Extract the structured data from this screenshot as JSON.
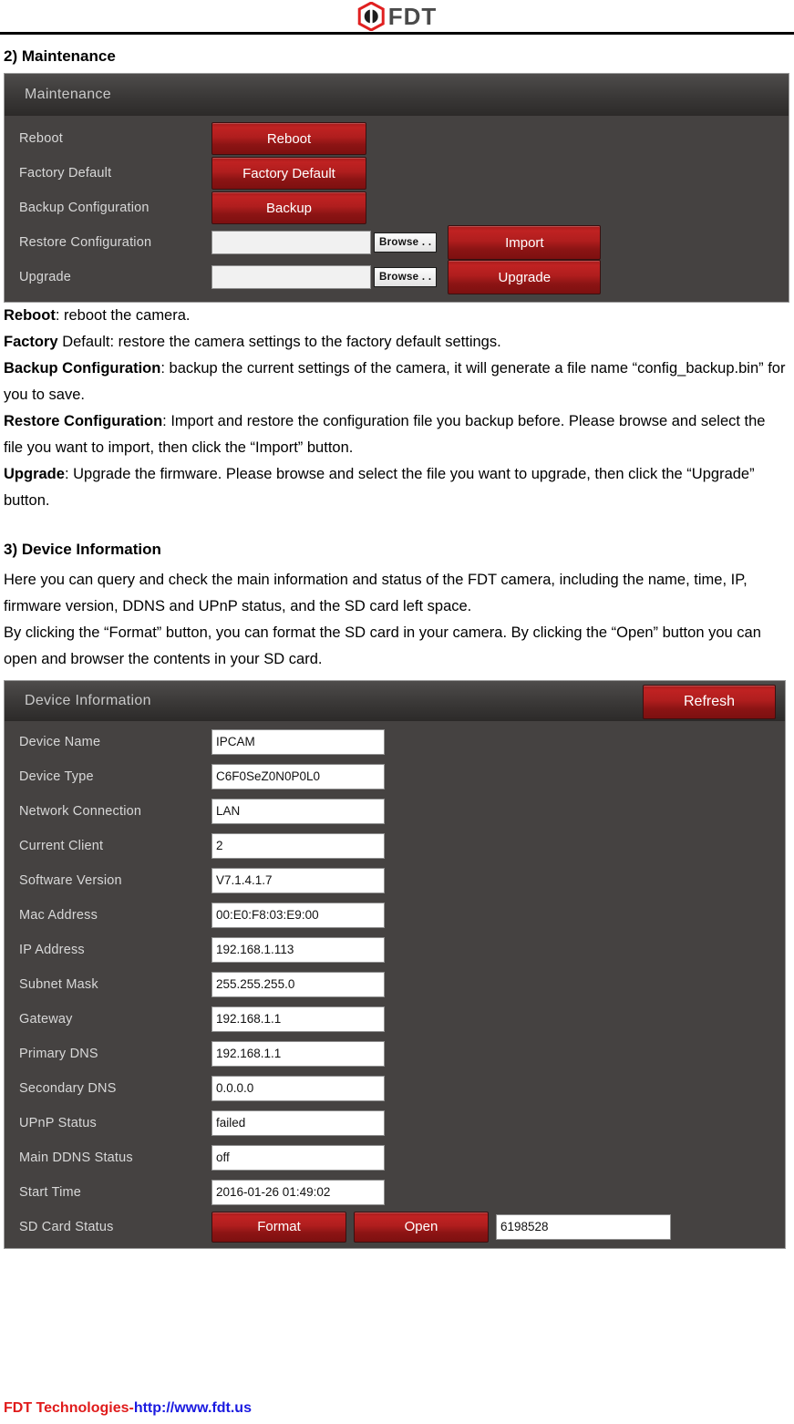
{
  "brand": {
    "logo_icon": "fdt-hexagon-logo-icon",
    "logo_text": "FDT"
  },
  "sections": {
    "maintenance_heading": "2) Maintenance",
    "device_info_heading": "3) Device Information"
  },
  "maintenance_panel": {
    "title": "Maintenance",
    "rows": {
      "reboot_label": "Reboot",
      "reboot_button": "Reboot",
      "factory_default_label": "Factory Default",
      "factory_default_button": "Factory Default",
      "backup_label": "Backup Configuration",
      "backup_button": "Backup",
      "restore_label": "Restore Configuration",
      "restore_input_value": "",
      "restore_browse_button": "Browse . .",
      "import_button": "Import",
      "upgrade_label": "Upgrade",
      "upgrade_input_value": "",
      "upgrade_browse_button": "Browse . .",
      "upgrade_button": "Upgrade"
    }
  },
  "maintenance_text": {
    "line1_bold": "Reboot",
    "line1_rest": ": reboot the camera.",
    "line2_bold": "Factory",
    "line2_rest": " Default: restore the camera settings to the factory default settings.",
    "line3_bold": "Backup Configuration",
    "line3_rest": ": backup the current settings of the camera, it will generate a file name “config_backup.bin” for you to save.",
    "line4_bold": "Restore Configuration",
    "line4_rest": ": Import and restore the configuration file you backup before. Please browse and select the file you want to import, then click the “Import” button.",
    "line5_bold": "Upgrade",
    "line5_rest": ": Upgrade the firmware. Please browse and select the file you want to upgrade, then click the “Upgrade” button."
  },
  "device_info_text": {
    "para1": "Here you can query and check the main information and status of the FDT camera, including the name, time, IP, firmware version, DDNS and UPnP status, and the SD card left space.",
    "para2": "By clicking the “Format” button, you can format the SD card in your camera. By clicking the “Open” button you can open and browser the contents in your SD card."
  },
  "device_info_panel": {
    "title": "Device Information",
    "refresh_button": "Refresh",
    "fields": [
      {
        "label": "Device Name",
        "value": "IPCAM"
      },
      {
        "label": "Device Type",
        "value": "C6F0SeZ0N0P0L0"
      },
      {
        "label": "Network Connection",
        "value": "LAN"
      },
      {
        "label": "Current Client",
        "value": "2"
      },
      {
        "label": "Software Version",
        "value": "V7.1.4.1.7"
      },
      {
        "label": "Mac Address",
        "value": "00:E0:F8:03:E9:00"
      },
      {
        "label": "IP Address",
        "value": "192.168.1.113"
      },
      {
        "label": "Subnet Mask",
        "value": "255.255.255.0"
      },
      {
        "label": "Gateway",
        "value": "192.168.1.1"
      },
      {
        "label": "Primary DNS",
        "value": "192.168.1.1"
      },
      {
        "label": "Secondary DNS",
        "value": "0.0.0.0"
      },
      {
        "label": "UPnP Status",
        "value": "failed"
      },
      {
        "label": "Main DDNS Status",
        "value": "off"
      },
      {
        "label": "Start Time",
        "value": "2016-01-26 01:49:02"
      }
    ],
    "sd_card": {
      "label": "SD Card Status",
      "format_button": "Format",
      "open_button": "Open",
      "free_space_value": "6198528"
    }
  },
  "footer": {
    "company": "FDT Technologies-",
    "url": "http://www.fdt.us"
  },
  "colors": {
    "button_red": "#b01e1e",
    "panel_body": "#454241",
    "panel_header": "#3a3837",
    "footer_red": "#e01b1b",
    "footer_blue": "#1a1ae0",
    "logo_red": "#e02020"
  }
}
